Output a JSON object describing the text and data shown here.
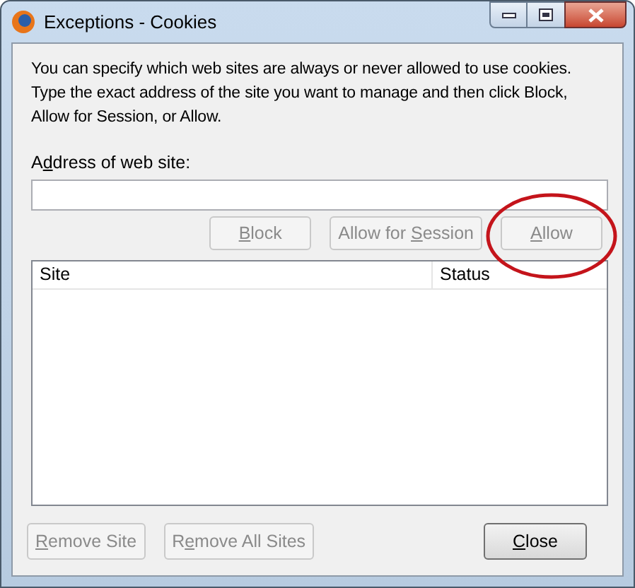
{
  "window": {
    "title": "Exceptions - Cookies"
  },
  "description": "You can specify which web sites are always or never allowed to use cookies. Type the exact address of the site you want to manage and then click Block, Allow for Session, or Allow.",
  "address": {
    "label": {
      "pre": "A",
      "key": "d",
      "post": "dress of web site:"
    }
  },
  "actions": [
    {
      "label": {
        "key": "B",
        "post": "lock"
      },
      "disabled": true,
      "highlighted": false
    },
    {
      "label": {
        "pre": "Allow for ",
        "key": "S",
        "post": "ession"
      },
      "disabled": true,
      "highlighted": false
    },
    {
      "label": {
        "key": "A",
        "post": "llow"
      },
      "disabled": true,
      "highlighted": true
    }
  ],
  "table": {
    "columns": [
      "Site",
      "Status"
    ]
  },
  "bottom_buttons": [
    {
      "label": {
        "key": "R",
        "post": "emove Site"
      },
      "disabled": true
    },
    {
      "label": {
        "pre": "R",
        "key": "e",
        "post": "move All Sites"
      },
      "disabled": true
    }
  ],
  "close_button": {
    "label": {
      "key": "C",
      "post": "lose"
    },
    "disabled": false
  }
}
